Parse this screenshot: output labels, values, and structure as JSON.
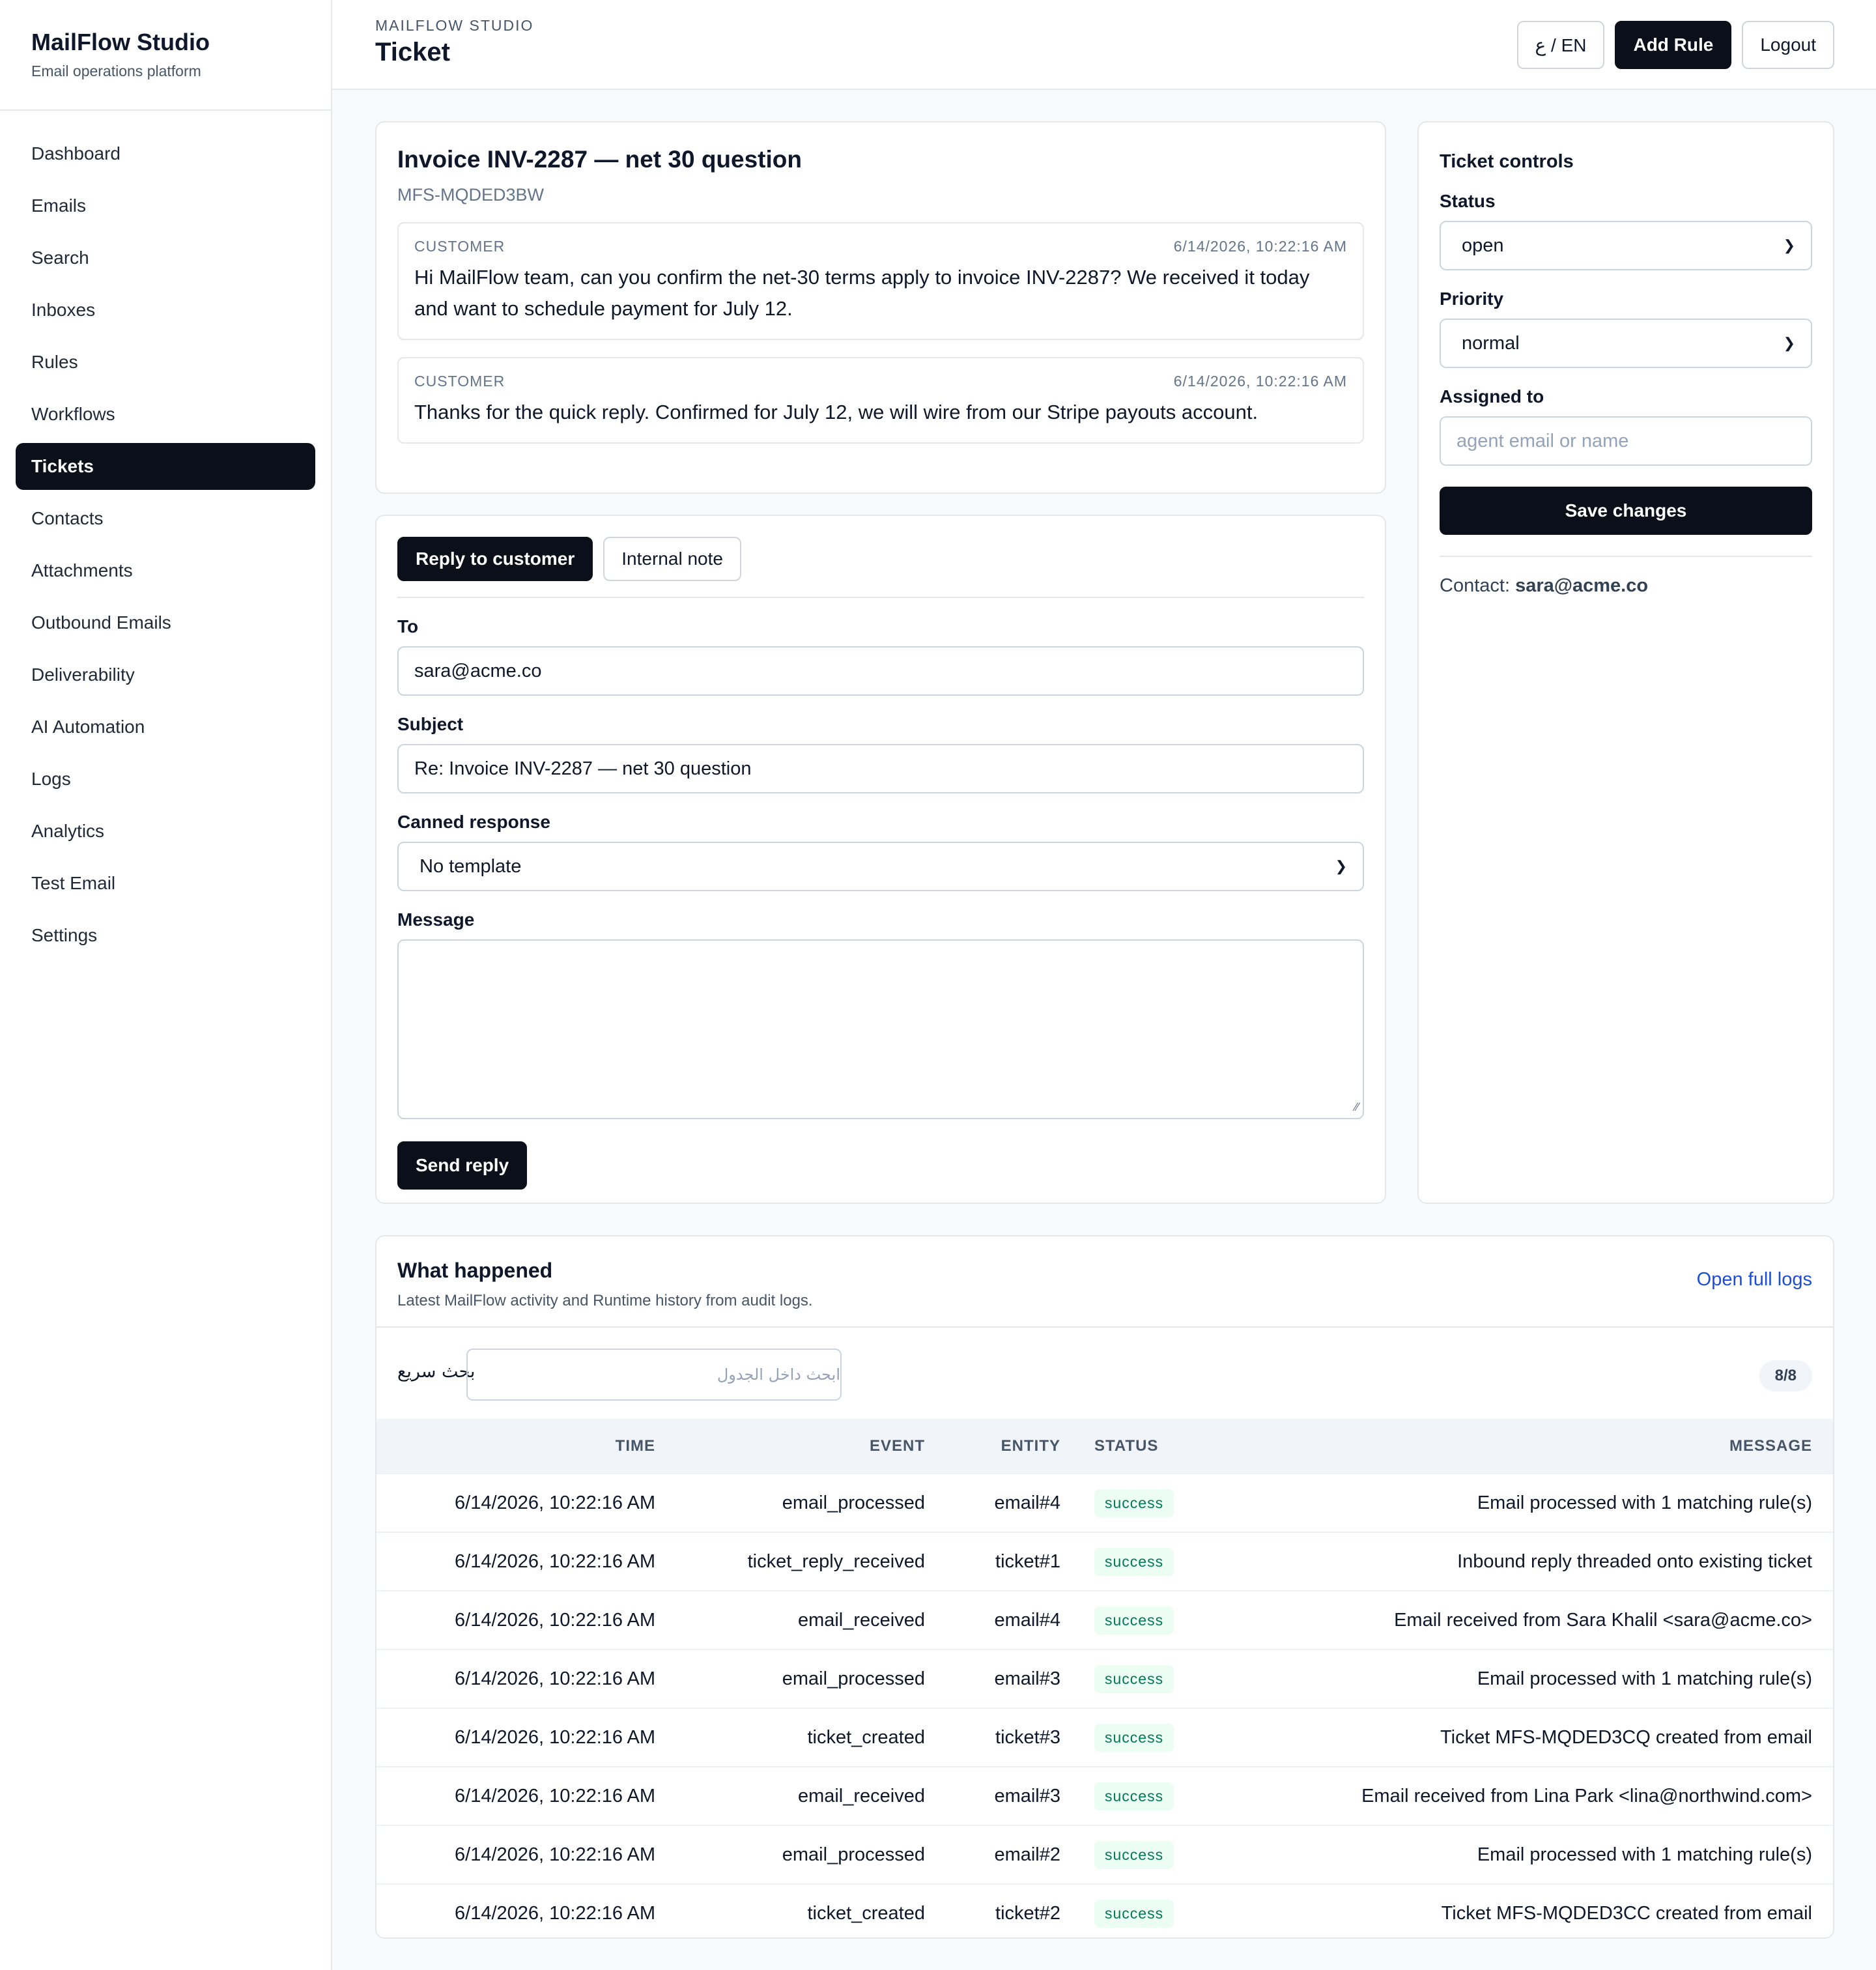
{
  "sidebar": {
    "brand_title": "MailFlow Studio",
    "brand_subtitle": "Email operations platform",
    "items": [
      {
        "label": "Dashboard"
      },
      {
        "label": "Emails"
      },
      {
        "label": "Search"
      },
      {
        "label": "Inboxes"
      },
      {
        "label": "Rules"
      },
      {
        "label": "Workflows"
      },
      {
        "label": "Tickets"
      },
      {
        "label": "Contacts"
      },
      {
        "label": "Attachments"
      },
      {
        "label": "Outbound Emails"
      },
      {
        "label": "Deliverability"
      },
      {
        "label": "AI Automation"
      },
      {
        "label": "Logs"
      },
      {
        "label": "Analytics"
      },
      {
        "label": "Test Email"
      },
      {
        "label": "Settings"
      }
    ],
    "active": "Tickets"
  },
  "header": {
    "eyebrow": "MAILFLOW STUDIO",
    "title": "Ticket",
    "lang_label": "ع / EN",
    "add_rule_label": "Add Rule",
    "logout_label": "Logout"
  },
  "ticket": {
    "title": "Invoice INV-2287 — net 30 question",
    "id": "MFS-MQDED3BW",
    "messages": [
      {
        "author": "CUSTOMER",
        "time": "6/14/2026, 10:22:16 AM",
        "body": "Hi MailFlow team, can you confirm the net-30 terms apply to invoice INV-2287? We received it today and want to schedule payment for July 12."
      },
      {
        "author": "CUSTOMER",
        "time": "6/14/2026, 10:22:16 AM",
        "body": "Thanks for the quick reply. Confirmed for July 12, we will wire from our Stripe payouts account."
      }
    ]
  },
  "reply": {
    "tab_reply": "Reply to customer",
    "tab_note": "Internal note",
    "to_label": "To",
    "to_value": "sara@acme.co",
    "subject_label": "Subject",
    "subject_value": "Re: Invoice INV-2287 — net 30 question",
    "canned_label": "Canned response",
    "canned_value": "No template",
    "message_label": "Message",
    "message_value": "",
    "send_label": "Send reply"
  },
  "controls": {
    "title": "Ticket controls",
    "status_label": "Status",
    "status_value": "open",
    "priority_label": "Priority",
    "priority_value": "normal",
    "assigned_label": "Assigned to",
    "assigned_placeholder": "agent email or name",
    "save_label": "Save changes",
    "contact_label": "Contact:",
    "contact_value": "sara@acme.co"
  },
  "logs": {
    "title": "What happened",
    "subtitle": "Latest MailFlow activity and Runtime history from audit logs.",
    "open_full": "Open full logs",
    "filter_label": "بحث سريع",
    "filter_placeholder": "ابحث داخل الجدول",
    "count": "8/8",
    "columns": [
      "TIME",
      "EVENT",
      "ENTITY",
      "STATUS",
      "MESSAGE"
    ],
    "rows": [
      {
        "time": "6/14/2026, 10:22:16 AM",
        "event": "email_processed",
        "entity": "email#4",
        "status": "success",
        "message": "Email processed with 1 matching rule(s)"
      },
      {
        "time": "6/14/2026, 10:22:16 AM",
        "event": "ticket_reply_received",
        "entity": "ticket#1",
        "status": "success",
        "message": "Inbound reply threaded onto existing ticket"
      },
      {
        "time": "6/14/2026, 10:22:16 AM",
        "event": "email_received",
        "entity": "email#4",
        "status": "success",
        "message": "Email received from Sara Khalil <sara@acme.co>"
      },
      {
        "time": "6/14/2026, 10:22:16 AM",
        "event": "email_processed",
        "entity": "email#3",
        "status": "success",
        "message": "Email processed with 1 matching rule(s)"
      },
      {
        "time": "6/14/2026, 10:22:16 AM",
        "event": "ticket_created",
        "entity": "ticket#3",
        "status": "success",
        "message": "Ticket MFS-MQDED3CQ created from email"
      },
      {
        "time": "6/14/2026, 10:22:16 AM",
        "event": "email_received",
        "entity": "email#3",
        "status": "success",
        "message": "Email received from Lina Park <lina@northwind.com>"
      },
      {
        "time": "6/14/2026, 10:22:16 AM",
        "event": "email_processed",
        "entity": "email#2",
        "status": "success",
        "message": "Email processed with 1 matching rule(s)"
      },
      {
        "time": "6/14/2026, 10:22:16 AM",
        "event": "ticket_created",
        "entity": "ticket#2",
        "status": "success",
        "message": "Ticket MFS-MQDED3CC created from email"
      }
    ]
  }
}
